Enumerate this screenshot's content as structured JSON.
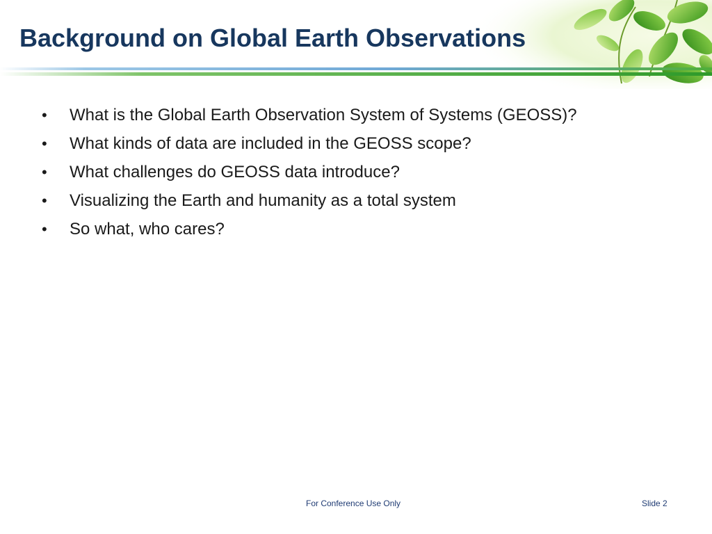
{
  "slide": {
    "title": "Background on Global Earth Observations",
    "bullets": [
      "What is the Global Earth Observation System of Systems (GEOSS)?",
      "What kinds of data are included in the GEOSS scope?",
      "What challenges do GEOSS data introduce?",
      "Visualizing the Earth and humanity as a total system",
      "So what, who cares?"
    ],
    "bullet_symbol": "•",
    "footer_center": "For Conference Use Only",
    "footer_right": "Slide 2"
  },
  "colors": {
    "title": "#17375e",
    "body_text": "#1a1a1a",
    "footer_text": "#1f3b73",
    "rule_blue": "#6fa8d6",
    "rule_green": "#3aa83a",
    "leaf_green": "#5fb830",
    "leaf_light": "#b9e07a"
  },
  "decor": {
    "header_image": "green-leaves-decoration"
  }
}
